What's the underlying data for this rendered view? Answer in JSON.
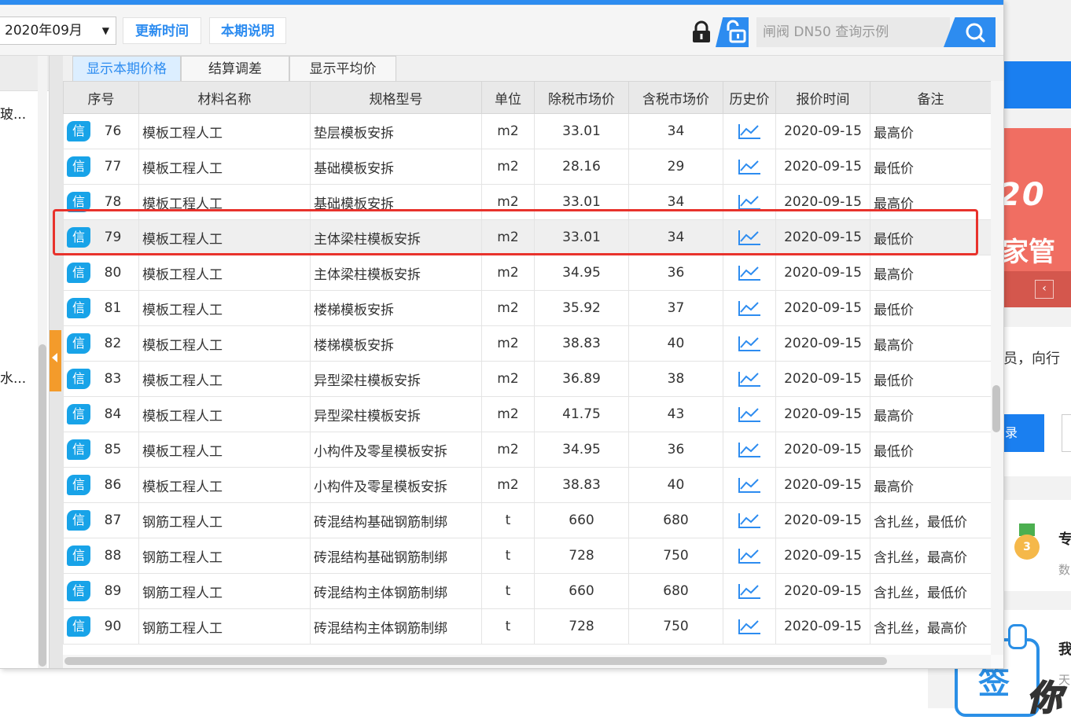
{
  "toolbar": {
    "period": "2020年09月",
    "update_time_label": "更新时间",
    "period_note_label": "本期说明",
    "search_placeholder": "闸阀 DN50 查询示例"
  },
  "left_panel": {
    "items": [
      "玻...",
      "水..."
    ]
  },
  "tabs": [
    {
      "label": "显示本期价格",
      "active": true
    },
    {
      "label": "结算调差",
      "active": false
    },
    {
      "label": "显示平均价",
      "active": false
    }
  ],
  "table": {
    "columns": [
      "序号",
      "材料名称",
      "规格型号",
      "单位",
      "除税市场价",
      "含税市场价",
      "历史价",
      "报价时间",
      "备注"
    ],
    "badge": "信",
    "rows": [
      {
        "no": "76",
        "name": "模板工程人工",
        "spec": "垫层模板安拆",
        "unit": "m2",
        "price_ex": "33.01",
        "price_in": "34",
        "date": "2020-09-15",
        "note": "最高价",
        "selected": false
      },
      {
        "no": "77",
        "name": "模板工程人工",
        "spec": "基础模板安拆",
        "unit": "m2",
        "price_ex": "28.16",
        "price_in": "29",
        "date": "2020-09-15",
        "note": "最低价",
        "selected": false
      },
      {
        "no": "78",
        "name": "模板工程人工",
        "spec": "基础模板安拆",
        "unit": "m2",
        "price_ex": "33.01",
        "price_in": "34",
        "date": "2020-09-15",
        "note": "最高价",
        "selected": false
      },
      {
        "no": "79",
        "name": "模板工程人工",
        "spec": "主体梁柱模板安拆",
        "unit": "m2",
        "price_ex": "33.01",
        "price_in": "34",
        "date": "2020-09-15",
        "note": "最低价",
        "selected": true
      },
      {
        "no": "80",
        "name": "模板工程人工",
        "spec": "主体梁柱模板安拆",
        "unit": "m2",
        "price_ex": "34.95",
        "price_in": "36",
        "date": "2020-09-15",
        "note": "最高价",
        "selected": false
      },
      {
        "no": "81",
        "name": "模板工程人工",
        "spec": "楼梯模板安拆",
        "unit": "m2",
        "price_ex": "35.92",
        "price_in": "37",
        "date": "2020-09-15",
        "note": "最低价",
        "selected": false
      },
      {
        "no": "82",
        "name": "模板工程人工",
        "spec": "楼梯模板安拆",
        "unit": "m2",
        "price_ex": "38.83",
        "price_in": "40",
        "date": "2020-09-15",
        "note": "最高价",
        "selected": false
      },
      {
        "no": "83",
        "name": "模板工程人工",
        "spec": "异型梁柱模板安拆",
        "unit": "m2",
        "price_ex": "36.89",
        "price_in": "38",
        "date": "2020-09-15",
        "note": "最低价",
        "selected": false
      },
      {
        "no": "84",
        "name": "模板工程人工",
        "spec": "异型梁柱模板安拆",
        "unit": "m2",
        "price_ex": "41.75",
        "price_in": "43",
        "date": "2020-09-15",
        "note": "最高价",
        "selected": false
      },
      {
        "no": "85",
        "name": "模板工程人工",
        "spec": "小构件及零星模板安拆",
        "unit": "m2",
        "price_ex": "34.95",
        "price_in": "36",
        "date": "2020-09-15",
        "note": "最低价",
        "selected": false
      },
      {
        "no": "86",
        "name": "模板工程人工",
        "spec": "小构件及零星模板安拆",
        "unit": "m2",
        "price_ex": "38.83",
        "price_in": "40",
        "date": "2020-09-15",
        "note": "最高价",
        "selected": false
      },
      {
        "no": "87",
        "name": "钢筋工程人工",
        "spec": "砖混结构基础钢筋制绑",
        "unit": "t",
        "price_ex": "660",
        "price_in": "680",
        "date": "2020-09-15",
        "note": "含扎丝，最低价",
        "selected": false
      },
      {
        "no": "88",
        "name": "钢筋工程人工",
        "spec": "砖混结构基础钢筋制绑",
        "unit": "t",
        "price_ex": "728",
        "price_in": "750",
        "date": "2020-09-15",
        "note": "含扎丝，最高价",
        "selected": false
      },
      {
        "no": "89",
        "name": "钢筋工程人工",
        "spec": "砖混结构主体钢筋制绑",
        "unit": "t",
        "price_ex": "660",
        "price_in": "680",
        "date": "2020-09-15",
        "note": "含扎丝，最低价",
        "selected": false
      },
      {
        "no": "90",
        "name": "钢筋工程人工",
        "spec": "砖混结构主体钢筋制绑",
        "unit": "t",
        "price_ex": "728",
        "price_in": "750",
        "date": "2020-09-15",
        "note": "含扎丝，最高价",
        "selected": false
      }
    ]
  },
  "background_page": {
    "banner_year": "20",
    "banner_text": "家管",
    "notice_text": "员，向行",
    "login_label": "录",
    "medal_number": "3",
    "item1_title": "专",
    "item1_sub": "数",
    "item2_title": "我",
    "item2_sub": "天",
    "sign_text": "签",
    "sign_deco": "你"
  },
  "colors": {
    "accent": "#2d8cf0",
    "badge": "#18a3e8",
    "highlight": "#e8322c",
    "splitter": "#f39b2b"
  }
}
